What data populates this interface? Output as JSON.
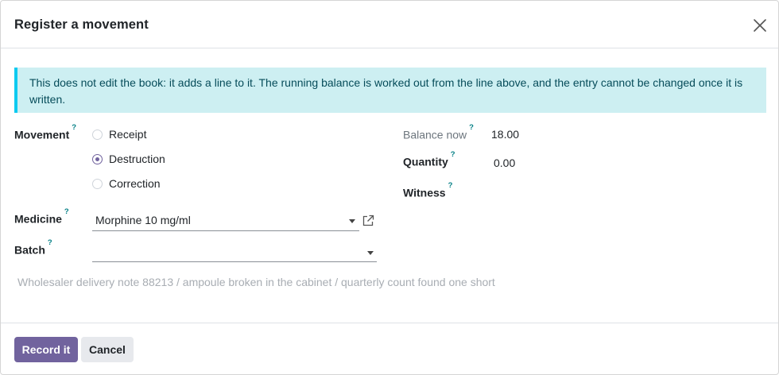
{
  "dialog": {
    "title": "Register a movement",
    "close_icon": "close-icon"
  },
  "alert": {
    "text": "This does not edit the book: it adds a line to it. The running balance is worked out from the line above, and the entry cannot be changed once it is written."
  },
  "form": {
    "help_marker": "?",
    "movement": {
      "label": "Movement",
      "options": [
        {
          "label": "Receipt",
          "checked": false
        },
        {
          "label": "Destruction",
          "checked": true
        },
        {
          "label": "Correction",
          "checked": false
        }
      ]
    },
    "medicine": {
      "label": "Medicine",
      "value": "Morphine 10 mg/ml",
      "link_icon": "external-link-icon"
    },
    "batch": {
      "label": "Batch",
      "value": ""
    },
    "balance_now": {
      "label": "Balance now",
      "value": "18.00"
    },
    "quantity": {
      "label": "Quantity",
      "value": "0.00"
    },
    "witness": {
      "label": "Witness",
      "value": ""
    },
    "note": {
      "placeholder": "Wholesaler delivery note 88213 / ampoule broken in the cabinet / quarterly count found one short"
    }
  },
  "footer": {
    "record_label": "Record it",
    "cancel_label": "Cancel"
  },
  "colors": {
    "primary": "#71639e",
    "alert_bg": "#cdeff2",
    "alert_border": "#0dcaf0",
    "help_marker": "#017e84"
  }
}
